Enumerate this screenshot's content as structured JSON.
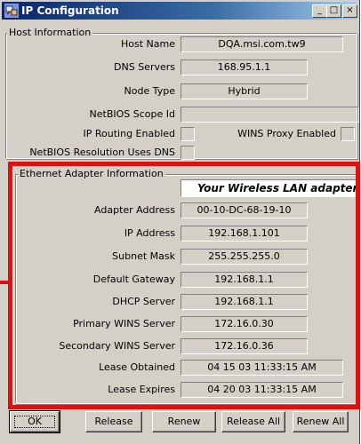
{
  "window": {
    "title": "IP Configuration",
    "controls": {
      "minimize": "_",
      "maximize": "□",
      "close": "×"
    }
  },
  "host": {
    "group_label": "Host Information",
    "host_name_label": "Host Name",
    "host_name_value": "DQA.msi.com.tw9",
    "dns_label": "DNS Servers",
    "dns_value": "168.95.1.1",
    "node_type_label": "Node Type",
    "node_type_value": "Hybrid",
    "netbios_scope_label": "NetBIOS Scope Id",
    "netbios_scope_value": "",
    "ip_routing_label": "IP Routing Enabled",
    "wins_proxy_label": "WINS Proxy Enabled",
    "netbios_dns_label": "NetBIOS Resolution Uses DNS"
  },
  "adapter": {
    "group_label": "Ethernet  Adapter Information",
    "selected_adapter": "Your Wireless LAN adapter n",
    "rows": [
      {
        "label": "Adapter Address",
        "value": "00-10-DC-68-19-10"
      },
      {
        "label": "IP Address",
        "value": "192.168.1.101"
      },
      {
        "label": "Subnet Mask",
        "value": "255.255.255.0"
      },
      {
        "label": "Default Gateway",
        "value": "192.168.1.1"
      },
      {
        "label": "DHCP Server",
        "value": "192.168.1.1"
      },
      {
        "label": "Primary WINS Server",
        "value": "172.16.0.30"
      },
      {
        "label": "Secondary WINS Server",
        "value": "172.16.0.36"
      },
      {
        "label": "Lease Obtained",
        "value": "04 15 03 11:33:15 AM"
      },
      {
        "label": "Lease Expires",
        "value": "04 20 03 11:33:15 AM"
      }
    ]
  },
  "buttons": {
    "ok": "OK",
    "release": "Release",
    "renew": "Renew",
    "release_all": "Release All",
    "renew_all": "Renew All"
  },
  "colors": {
    "highlight": "#e01010",
    "title_bar": "#0a246a"
  }
}
